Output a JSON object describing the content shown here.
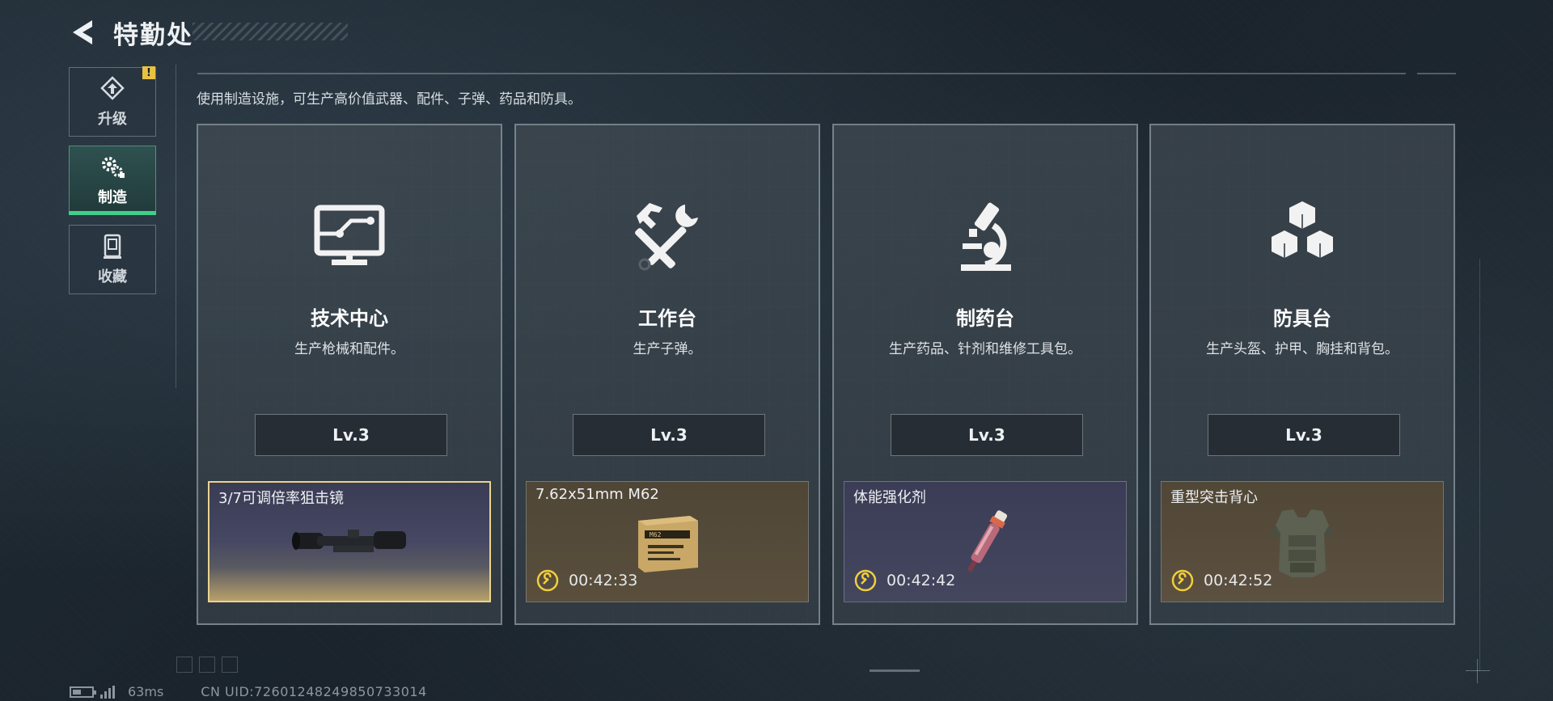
{
  "header": {
    "title": "特勤处"
  },
  "description": "使用制造设施，可生产高价值武器、配件、子弹、药品和防具。",
  "sidebar": {
    "items": [
      {
        "label": "升级",
        "icon": "upgrade-icon",
        "active": false,
        "alert": "!"
      },
      {
        "label": "制造",
        "icon": "craft-gears-icon",
        "active": true
      },
      {
        "label": "收藏",
        "icon": "collection-icon",
        "active": false
      }
    ]
  },
  "stations": [
    {
      "name": "技术中心",
      "subtitle": "生产枪械和配件。",
      "icon": "monitor-circuit-icon",
      "level": "Lv.3",
      "product": {
        "name": "3/7可调倍率狙击镜",
        "timer": "",
        "image": "scope-image",
        "rarity_color": "#e9d48e"
      }
    },
    {
      "name": "工作台",
      "subtitle": "生产子弹。",
      "icon": "hammer-wrench-icon",
      "level": "Lv.3",
      "product": {
        "name": "7.62x51mm M62",
        "timer": "00:42:33",
        "image": "ammo-box-image",
        "rarity_color": "#5a4f3d"
      }
    },
    {
      "name": "制药台",
      "subtitle": "生产药品、针剂和维修工具包。",
      "icon": "microscope-icon",
      "level": "Lv.3",
      "product": {
        "name": "体能强化剂",
        "timer": "00:42:42",
        "image": "injector-image",
        "rarity_color": "#44465e"
      }
    },
    {
      "name": "防具台",
      "subtitle": "生产头盔、护甲、胸挂和背包。",
      "icon": "cubes-icon",
      "level": "Lv.3",
      "product": {
        "name": "重型突击背心",
        "timer": "00:42:52",
        "image": "vest-image",
        "rarity_color": "#5c5040"
      }
    }
  ],
  "footer": {
    "ping": "63ms",
    "uid": "CN UID:72601248249850733014"
  },
  "colors": {
    "accent_green": "#3fd08a",
    "alert_yellow": "#e8c245",
    "timer_yellow": "#f0cf3c"
  }
}
